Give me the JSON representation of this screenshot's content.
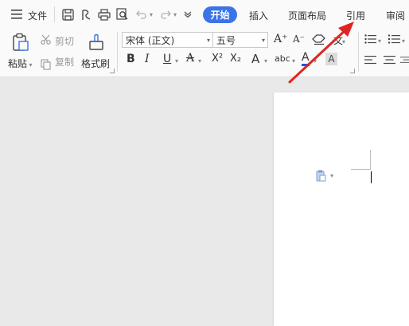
{
  "menu": {
    "hamburger_icon": "menu-icon",
    "file_label": "文件",
    "tabs": [
      {
        "label": "开始",
        "active": true
      },
      {
        "label": "插入",
        "active": false
      },
      {
        "label": "页面布局",
        "active": false
      },
      {
        "label": "引用",
        "active": false
      },
      {
        "label": "审阅",
        "active": false
      }
    ]
  },
  "clipboard": {
    "paste_label": "粘贴",
    "cut_label": "剪切",
    "copy_label": "复制",
    "format_painter_label": "格式刷"
  },
  "font": {
    "family": "宋体 (正文)",
    "size": "五号",
    "bold": "B",
    "italic": "I",
    "underline": "U",
    "color_a": "A",
    "superscript": "X²",
    "subscript": "X₂",
    "text_effect": "A",
    "pinyin": "abc",
    "highlight": "A",
    "shade": "A",
    "grow": "A⁺",
    "shrink": "A⁻",
    "clear": "文"
  },
  "colors": {
    "accent": "#3b73e8",
    "arrow": "#e02424",
    "font_color_underline": "#e03c3c",
    "highlight_underline": "#2b4fd8"
  }
}
